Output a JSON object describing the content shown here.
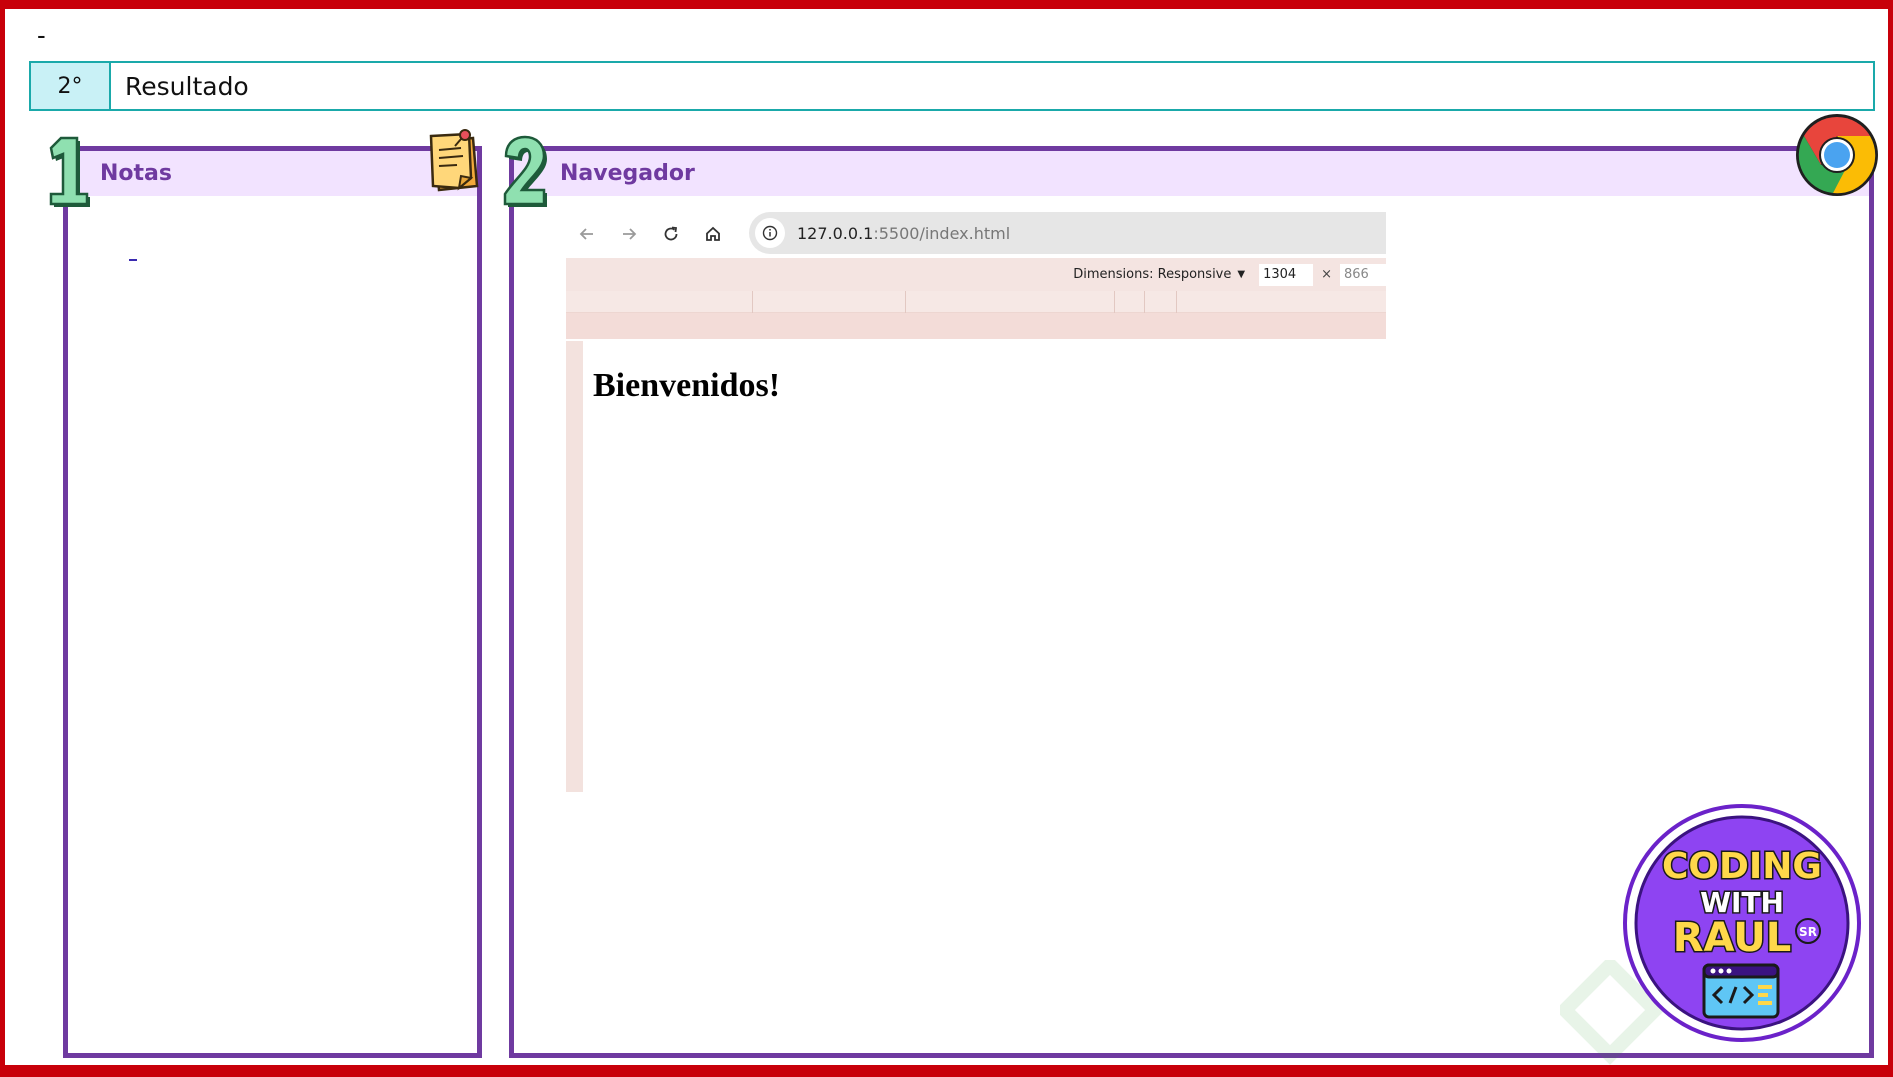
{
  "top_marker": "-",
  "step": {
    "number": "2°",
    "title": "Resultado"
  },
  "notes_panel": {
    "index": "1",
    "title": "Notas",
    "note_text": "-"
  },
  "browser_panel": {
    "index": "2",
    "title": "Navegador",
    "screenshot": {
      "url_host": "127.0.0.1",
      "url_path": ":5500/index.html",
      "dimensions_label": "Dimensions: Responsive",
      "width_value": "1304",
      "times": "×",
      "height_value": "866",
      "page_heading": "Bienvenidos!"
    }
  },
  "badge": {
    "line1": "CODING",
    "line2": "WITH",
    "line3": "RAUL",
    "suffix": "SR"
  },
  "colors": {
    "frame_red": "#c8000a",
    "panel_purple": "#6f3aa0",
    "panel_header_bg": "#f2e3ff",
    "step_teal": "#1aa9aa",
    "step_num_bg": "#c9f1f6",
    "number_green": "#8fe0b0"
  },
  "icons": [
    "sticky-note-icon",
    "chrome-icon",
    "back-arrow-icon",
    "forward-arrow-icon",
    "reload-icon",
    "home-icon",
    "info-icon"
  ]
}
